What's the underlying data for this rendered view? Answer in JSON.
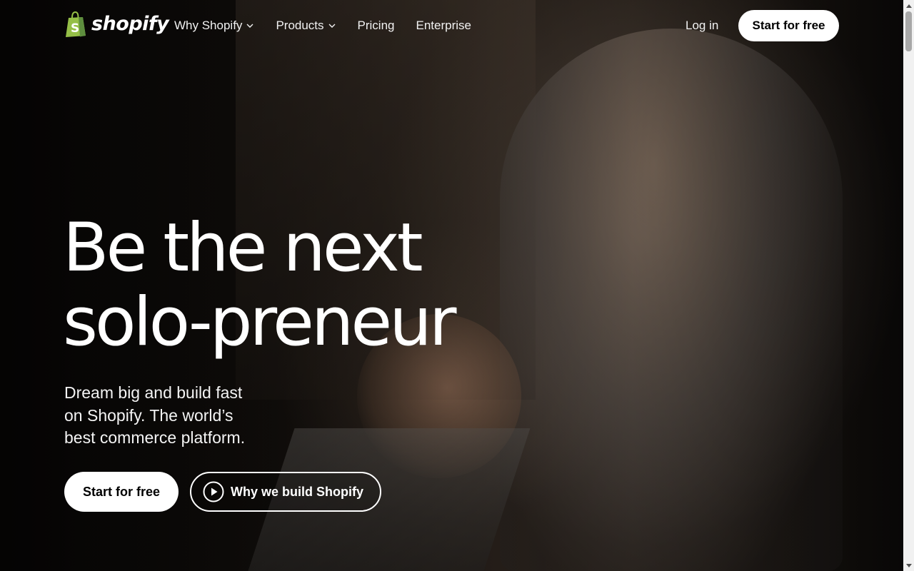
{
  "header": {
    "logo_text": "shopify",
    "logo_bag_letter": "S",
    "nav": [
      {
        "label": "Why Shopify",
        "has_dropdown": true
      },
      {
        "label": "Products",
        "has_dropdown": true
      },
      {
        "label": "Pricing",
        "has_dropdown": false
      },
      {
        "label": "Enterprise",
        "has_dropdown": false
      }
    ],
    "login_label": "Log in",
    "cta_label": "Start for free"
  },
  "hero": {
    "title_line1": "Be the next",
    "title_line2": "solo-preneur",
    "subtitle": "Dream big and build fast on Shopify. The world’s best commerce platform.",
    "primary_cta": "Start for free",
    "secondary_cta": "Why we build Shopify",
    "secondary_cta_icon": "play-icon"
  },
  "colors": {
    "brand_green": "#95BF47",
    "brand_green_dark": "#5E8E3E",
    "button_bg": "#FFFFFF",
    "button_text": "#000000"
  }
}
